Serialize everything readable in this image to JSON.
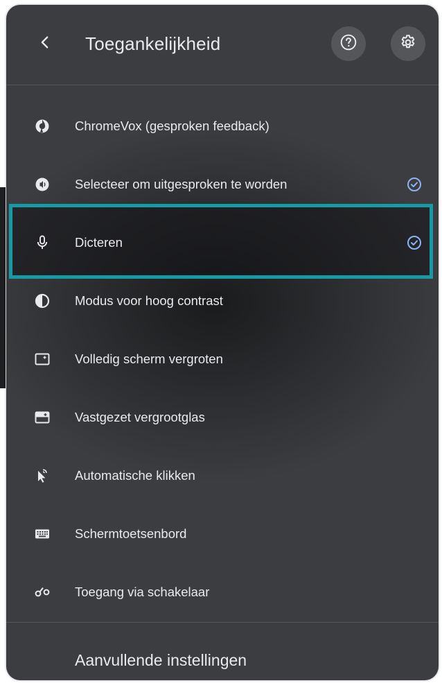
{
  "header": {
    "title": "Toegankelijkheid",
    "back_icon": "chevron-left-icon",
    "help_icon": "help-circle-icon",
    "settings_icon": "gear-icon"
  },
  "items": [
    {
      "label": "ChromeVox (gesproken feedback)",
      "icon": "chromevox-icon",
      "checked": false
    },
    {
      "label": "Selecteer om uitgesproken te worden",
      "icon": "select-to-speak-icon",
      "checked": true
    },
    {
      "label": "Dicteren",
      "icon": "microphone-icon",
      "checked": true,
      "highlighted": true
    },
    {
      "label": "Modus voor hoog contrast",
      "icon": "contrast-icon",
      "checked": false
    },
    {
      "label": "Volledig scherm vergroten",
      "icon": "fullscreen-magnifier-icon",
      "checked": false
    },
    {
      "label": "Vastgezet vergrootglas",
      "icon": "docked-magnifier-icon",
      "checked": false
    },
    {
      "label": "Automatische klikken",
      "icon": "autoclick-icon",
      "checked": false
    },
    {
      "label": "Schermtoetsenbord",
      "icon": "keyboard-icon",
      "checked": false
    },
    {
      "label": "Toegang via schakelaar",
      "icon": "switch-access-icon",
      "checked": false
    }
  ],
  "footer": {
    "label": "Aanvullende instellingen"
  },
  "colors": {
    "panel_bg": "#3c3d40",
    "text": "#e8eaed",
    "check_accent": "#8ab4f8",
    "highlight_border": "#169aa6"
  }
}
